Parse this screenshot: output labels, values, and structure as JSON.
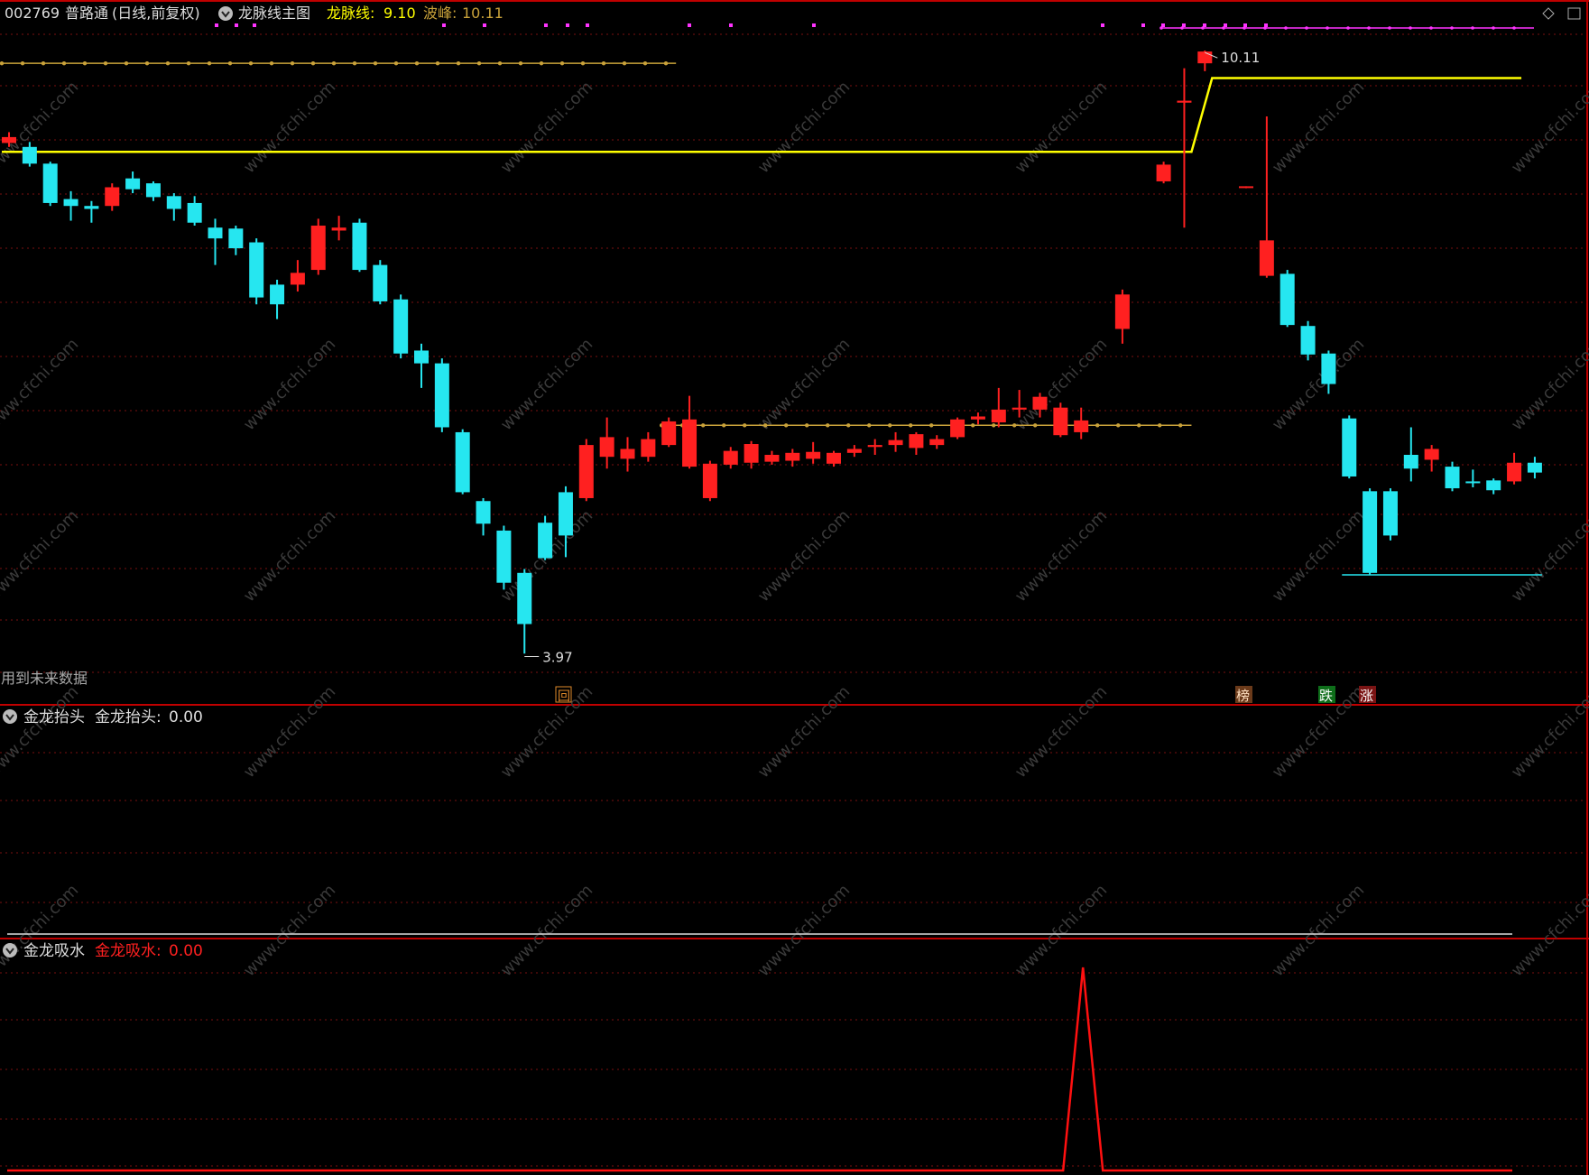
{
  "colors": {
    "up": "#ff2020",
    "down": "#26e6f0",
    "yellow": "#ffff00",
    "gold": "#c9a23a",
    "magenta": "#ff33ff",
    "grid": "#7a1010",
    "frame": "#c00000",
    "grey_label": "#aaaaaa",
    "red_line": "#ff1010"
  },
  "header": {
    "code": "002769",
    "name": "普路通",
    "period": "(日线,前复权)",
    "indicator_name": "龙脉线主图",
    "line_label": "龙脉线:",
    "line_value": "9.10",
    "peak_label": "波峰:",
    "peak_value": "10.11"
  },
  "main_panel": {
    "future_data_note": "用到未来数据",
    "high_label": "10.11",
    "low_label": "3.97",
    "signal_huei": "回",
    "signal_bang": "榜",
    "signal_die": "跌",
    "signal_zhang": "涨"
  },
  "panel2": {
    "title": "金龙抬头",
    "value_label": "金龙抬头:",
    "value": "0.00"
  },
  "panel3": {
    "title": "金龙吸水",
    "value_label": "金龙吸水:",
    "value": "0.00"
  },
  "watermark": "www.cfchi.com",
  "chart_data": {
    "type": "candlestick",
    "price_scale": {
      "ymin": 3.8,
      "ymax": 10.35
    },
    "dragon_line": [
      {
        "from": 0,
        "to": 57,
        "value": 9.1
      },
      {
        "from": 58,
        "to": 73,
        "value": 9.85
      }
    ],
    "gold_dotted": [
      {
        "from": 0,
        "to": 32,
        "value": 10.0
      },
      {
        "from": 32,
        "to": 57,
        "value": 6.32
      }
    ],
    "support_line": {
      "from": 65,
      "to": 74,
      "value": 4.8
    },
    "peak_value": 10.11,
    "low_value": 3.97,
    "candles": [
      {
        "o": 9.19,
        "c": 9.25,
        "h": 9.3,
        "l": 9.15
      },
      {
        "o": 9.15,
        "c": 8.98,
        "h": 9.2,
        "l": 8.95
      },
      {
        "o": 8.98,
        "c": 8.58,
        "h": 9.0,
        "l": 8.55
      },
      {
        "o": 8.62,
        "c": 8.55,
        "h": 8.7,
        "l": 8.4
      },
      {
        "o": 8.55,
        "c": 8.52,
        "h": 8.6,
        "l": 8.38
      },
      {
        "o": 8.55,
        "c": 8.74,
        "h": 8.78,
        "l": 8.5
      },
      {
        "o": 8.83,
        "c": 8.72,
        "h": 8.9,
        "l": 8.68
      },
      {
        "o": 8.78,
        "c": 8.64,
        "h": 8.8,
        "l": 8.6
      },
      {
        "o": 8.65,
        "c": 8.52,
        "h": 8.68,
        "l": 8.4
      },
      {
        "o": 8.58,
        "c": 8.38,
        "h": 8.65,
        "l": 8.35
      },
      {
        "o": 8.33,
        "c": 8.22,
        "h": 8.42,
        "l": 7.95
      },
      {
        "o": 8.32,
        "c": 8.12,
        "h": 8.35,
        "l": 8.05
      },
      {
        "o": 8.18,
        "c": 7.62,
        "h": 8.22,
        "l": 7.55
      },
      {
        "o": 7.75,
        "c": 7.55,
        "h": 7.8,
        "l": 7.4
      },
      {
        "o": 7.75,
        "c": 7.87,
        "h": 8.0,
        "l": 7.68
      },
      {
        "o": 7.9,
        "c": 8.35,
        "h": 8.42,
        "l": 7.85
      },
      {
        "o": 8.3,
        "c": 8.33,
        "h": 8.45,
        "l": 8.2
      },
      {
        "o": 8.38,
        "c": 7.9,
        "h": 8.42,
        "l": 7.88
      },
      {
        "o": 7.95,
        "c": 7.58,
        "h": 8.0,
        "l": 7.55
      },
      {
        "o": 7.6,
        "c": 7.05,
        "h": 7.65,
        "l": 7.0
      },
      {
        "o": 7.08,
        "c": 6.95,
        "h": 7.15,
        "l": 6.7
      },
      {
        "o": 6.95,
        "c": 6.3,
        "h": 7.0,
        "l": 6.25
      },
      {
        "o": 6.25,
        "c": 5.64,
        "h": 6.28,
        "l": 5.62
      },
      {
        "o": 5.55,
        "c": 5.32,
        "h": 5.58,
        "l": 5.2
      },
      {
        "o": 5.25,
        "c": 4.72,
        "h": 5.3,
        "l": 4.65
      },
      {
        "o": 4.82,
        "c": 4.3,
        "h": 4.86,
        "l": 4.0
      },
      {
        "o": 5.33,
        "c": 4.97,
        "h": 5.4,
        "l": 4.95
      },
      {
        "o": 5.64,
        "c": 5.2,
        "h": 5.7,
        "l": 4.98
      },
      {
        "o": 5.58,
        "c": 6.12,
        "h": 6.18,
        "l": 5.55
      },
      {
        "o": 6.0,
        "c": 6.2,
        "h": 6.4,
        "l": 5.88
      },
      {
        "o": 5.98,
        "c": 6.08,
        "h": 6.2,
        "l": 5.85
      },
      {
        "o": 6.0,
        "c": 6.18,
        "h": 6.25,
        "l": 5.95
      },
      {
        "o": 6.12,
        "c": 6.36,
        "h": 6.4,
        "l": 6.1
      },
      {
        "o": 5.9,
        "c": 6.38,
        "h": 6.62,
        "l": 5.88
      },
      {
        "o": 5.58,
        "c": 5.93,
        "h": 5.96,
        "l": 5.55
      },
      {
        "o": 5.92,
        "c": 6.06,
        "h": 6.1,
        "l": 5.88
      },
      {
        "o": 5.94,
        "c": 6.13,
        "h": 6.16,
        "l": 5.88
      },
      {
        "o": 5.95,
        "c": 6.02,
        "h": 6.06,
        "l": 5.92
      },
      {
        "o": 5.96,
        "c": 6.04,
        "h": 6.08,
        "l": 5.9
      },
      {
        "o": 5.98,
        "c": 6.05,
        "h": 6.15,
        "l": 5.93
      },
      {
        "o": 5.93,
        "c": 6.04,
        "h": 6.06,
        "l": 5.9
      },
      {
        "o": 6.04,
        "c": 6.08,
        "h": 6.12,
        "l": 6.0
      },
      {
        "o": 6.1,
        "c": 6.12,
        "h": 6.18,
        "l": 6.02
      },
      {
        "o": 6.12,
        "c": 6.17,
        "h": 6.25,
        "l": 6.05
      },
      {
        "o": 6.09,
        "c": 6.23,
        "h": 6.25,
        "l": 6.02
      },
      {
        "o": 6.12,
        "c": 6.18,
        "h": 6.22,
        "l": 6.08
      },
      {
        "o": 6.2,
        "c": 6.38,
        "h": 6.4,
        "l": 6.18
      },
      {
        "o": 6.38,
        "c": 6.41,
        "h": 6.45,
        "l": 6.33
      },
      {
        "o": 6.35,
        "c": 6.48,
        "h": 6.7,
        "l": 6.3
      },
      {
        "o": 6.48,
        "c": 6.5,
        "h": 6.68,
        "l": 6.4
      },
      {
        "o": 6.48,
        "c": 6.61,
        "h": 6.65,
        "l": 6.4
      },
      {
        "o": 6.22,
        "c": 6.5,
        "h": 6.55,
        "l": 6.2
      },
      {
        "o": 6.25,
        "c": 6.37,
        "h": 6.5,
        "l": 6.18
      },
      {
        "o": null,
        "c": null,
        "h": null,
        "l": null
      },
      {
        "o": 7.3,
        "c": 7.65,
        "h": 7.7,
        "l": 7.15
      },
      {
        "o": null,
        "c": null,
        "h": null,
        "l": null
      },
      {
        "o": 8.8,
        "c": 8.97,
        "h": 9.0,
        "l": 8.78
      },
      {
        "o": 9.6,
        "c": 9.62,
        "h": 9.95,
        "l": 8.33
      },
      {
        "o": 10.0,
        "c": 10.12,
        "h": 10.13,
        "l": 9.92
      },
      {
        "o": null,
        "c": null,
        "h": null,
        "l": null
      },
      {
        "o": 8.74,
        "c": 8.75,
        "h": 8.75,
        "l": 8.73
      },
      {
        "o": 7.84,
        "c": 8.2,
        "h": 9.46,
        "l": 7.82
      },
      {
        "o": 7.86,
        "c": 7.34,
        "h": 7.9,
        "l": 7.32
      },
      {
        "o": 7.33,
        "c": 7.04,
        "h": 7.38,
        "l": 6.98
      },
      {
        "o": 7.05,
        "c": 6.74,
        "h": 7.08,
        "l": 6.64
      },
      {
        "o": 6.39,
        "c": 5.8,
        "h": 6.42,
        "l": 5.78
      },
      {
        "o": 5.65,
        "c": 4.82,
        "h": 5.68,
        "l": 4.8
      },
      {
        "o": 5.65,
        "c": 5.2,
        "h": 5.68,
        "l": 5.15
      },
      {
        "o": 6.02,
        "c": 5.88,
        "h": 6.3,
        "l": 5.75
      },
      {
        "o": 5.97,
        "c": 6.08,
        "h": 6.12,
        "l": 5.85
      },
      {
        "o": 5.9,
        "c": 5.68,
        "h": 5.95,
        "l": 5.65
      },
      {
        "o": 5.75,
        "c": 5.74,
        "h": 5.87,
        "l": 5.69
      },
      {
        "o": 5.76,
        "c": 5.66,
        "h": 5.78,
        "l": 5.62
      },
      {
        "o": 5.75,
        "c": 5.94,
        "h": 6.04,
        "l": 5.72
      },
      {
        "o": 5.94,
        "c": 5.84,
        "h": 6.0,
        "l": 5.78
      }
    ],
    "panel2_series": {
      "name": "金龙抬头",
      "value": 0.0
    },
    "panel3_series": {
      "name": "金龙吸水",
      "peak_index": 52,
      "peak_value": 1.0
    }
  }
}
